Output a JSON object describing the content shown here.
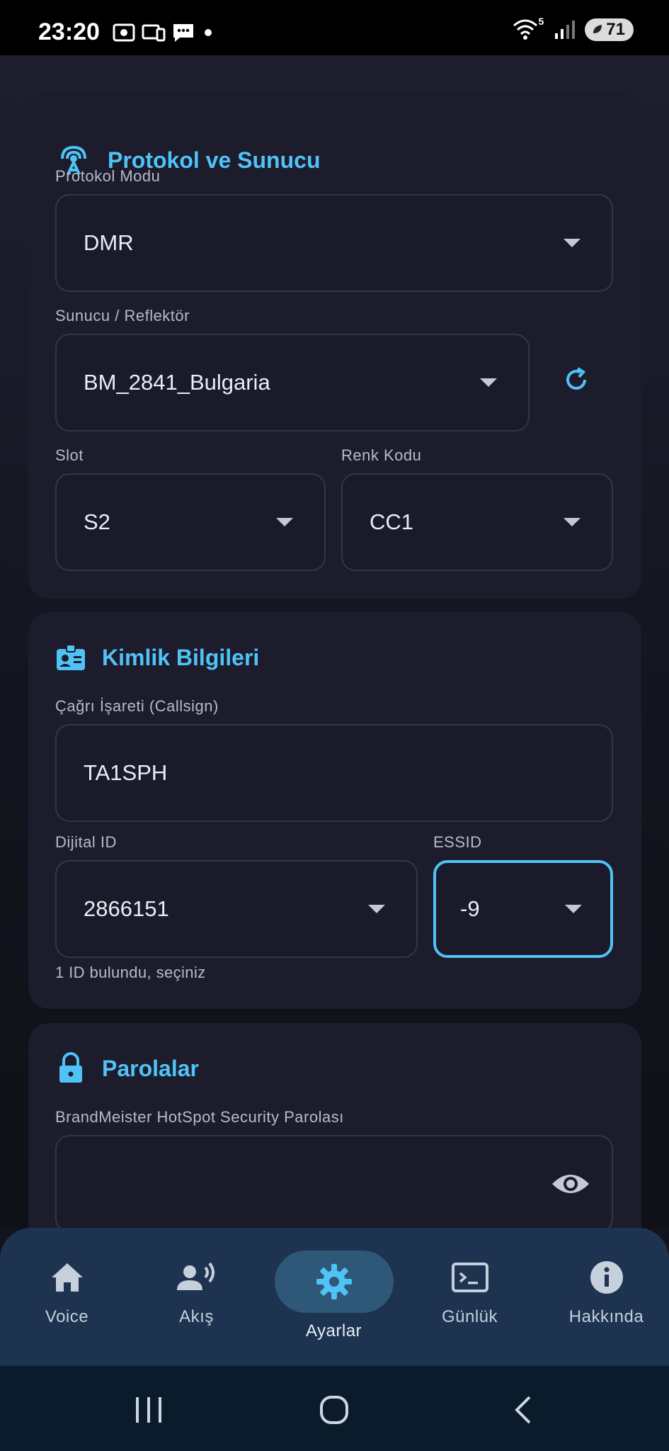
{
  "statusbar": {
    "time": "23:20",
    "battery": "71",
    "wifi_label": "5"
  },
  "colors": {
    "accent": "#4fc3f7",
    "card": "#1c1c2c",
    "nav": "#1d3350"
  },
  "protocol_card": {
    "title": "Protokol ve Sunucu",
    "protocol_label": "Protokol Modu",
    "protocol_value": "DMR",
    "server_label": "Sunucu / Reflektör",
    "server_value": "BM_2841_Bulgaria",
    "slot_label": "Slot",
    "slot_value": "S2",
    "color_code_label": "Renk Kodu",
    "color_code_value": "CC1"
  },
  "identity_card": {
    "title": "Kimlik Bilgileri",
    "callsign_label": "Çağrı İşareti (Callsign)",
    "callsign_value": "TA1SPH",
    "digital_id_label": "Dijital ID",
    "digital_id_value": "2866151",
    "essid_label": "ESSID",
    "essid_value": "-9",
    "helper": "1 ID bulundu, seçiniz"
  },
  "password_card": {
    "title": "Parolalar",
    "bm_password_label": "BrandMeister HotSpot Security Parolası",
    "bm_password_value": ""
  },
  "bottom_nav": [
    {
      "label": "Voice",
      "icon": "home-icon"
    },
    {
      "label": "Akış",
      "icon": "voice-user-icon"
    },
    {
      "label": "Ayarlar",
      "icon": "gear-icon"
    },
    {
      "label": "Günlük",
      "icon": "terminal-icon"
    },
    {
      "label": "Hakkında",
      "icon": "info-icon"
    }
  ]
}
